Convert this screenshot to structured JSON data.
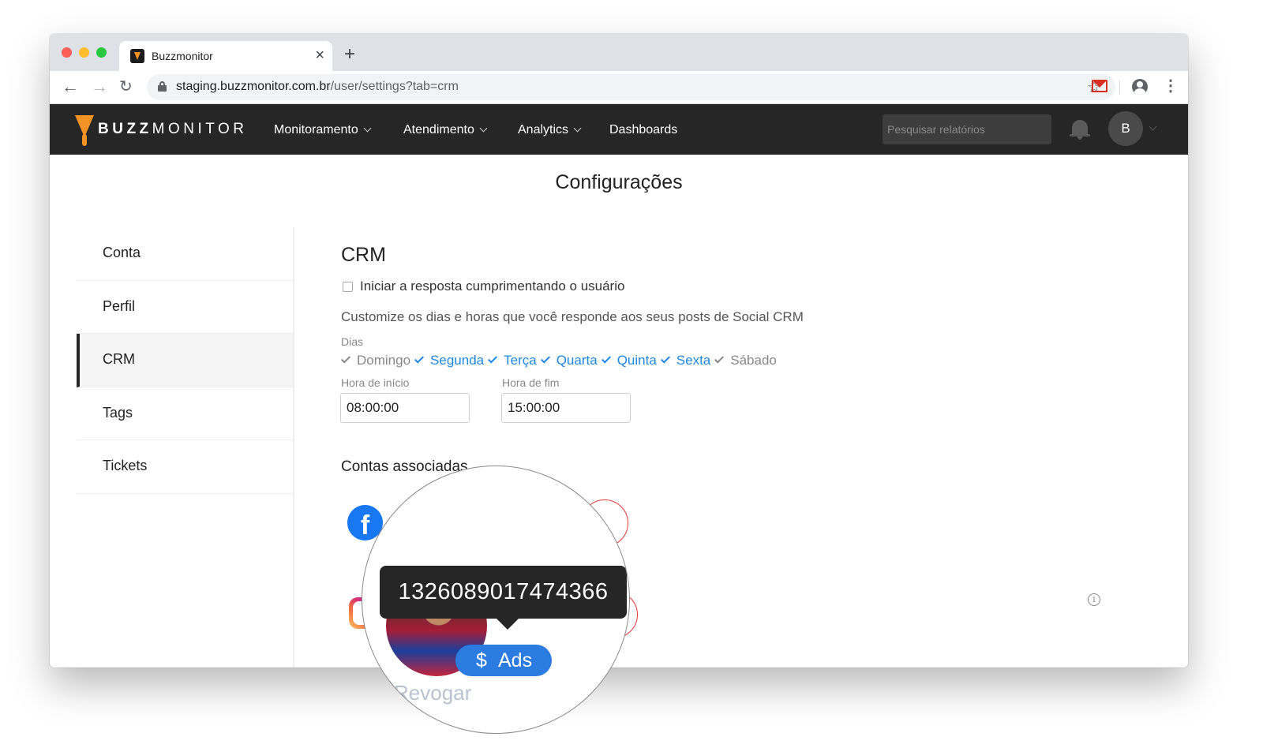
{
  "browser": {
    "tab_title": "Buzzmonitor",
    "url_host": "staging.buzzmonitor.com.br",
    "url_path": "/user/settings?tab=crm"
  },
  "app": {
    "brand_bold": "BUZZ",
    "brand_light": "MONITOR",
    "nav": {
      "monitoramento": "Monitoramento",
      "atendimento": "Atendimento",
      "analytics": "Analytics",
      "dashboards": "Dashboards"
    },
    "search_placeholder": "Pesquisar relatórios",
    "avatar_initial": "B"
  },
  "page": {
    "title": "Configurações",
    "sidebar": [
      "Conta",
      "Perfil",
      "CRM",
      "Tags",
      "Tickets"
    ],
    "active_sidebar_item": "CRM"
  },
  "crm": {
    "title": "CRM",
    "greet_label": "Iniciar a resposta cumprimentando o usuário",
    "greet_checked": false,
    "customize_text": "Customize os dias e horas que você responde aos seus posts de Social CRM",
    "days_label": "Dias",
    "days": [
      {
        "label": "Domingo",
        "on": false
      },
      {
        "label": "Segunda",
        "on": true
      },
      {
        "label": "Terça",
        "on": true
      },
      {
        "label": "Quarta",
        "on": true
      },
      {
        "label": "Quinta",
        "on": true
      },
      {
        "label": "Sexta",
        "on": true
      },
      {
        "label": "Sábado",
        "on": false
      }
    ],
    "start_label": "Hora de início",
    "start_value": "08:00:00",
    "end_label": "Hora de fim",
    "end_value": "15:00:00",
    "assoc_title": "Contas associadas"
  },
  "magnifier": {
    "tooltip_id": "1326089017474366",
    "ads_symbol": "$",
    "ads_label": "Ads",
    "revoke_label": "Revogar"
  },
  "colors": {
    "navbar": "#262626",
    "accent": "#1e88e5",
    "brand_orange": "#f39325",
    "ads_pill": "#2b7be0"
  }
}
